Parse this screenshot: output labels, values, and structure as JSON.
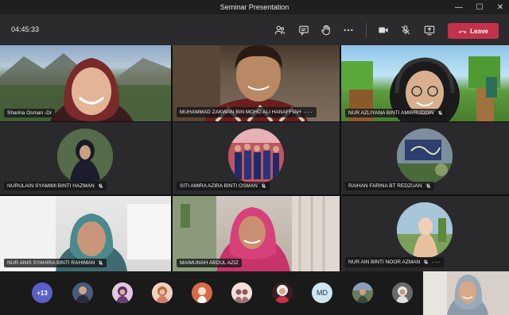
{
  "window": {
    "title": "Seminar Presentation",
    "controls": [
      "—",
      "☐",
      "✕"
    ]
  },
  "toolbar": {
    "timer": "04:45:33",
    "leave_label": "Leave",
    "icons": [
      "people-icon",
      "chat-icon",
      "raise-hand-icon",
      "more-options-icon",
      "camera-icon",
      "mic-off-icon",
      "share-screen-icon"
    ]
  },
  "tiles": [
    {
      "name": "Sharina Osman -Dr",
      "mic_off": false,
      "more": false
    },
    {
      "name": "MUHAMMAD ZAKWAN BIN MOHD ALI HANAFFIAH",
      "mic_off": false,
      "more": true
    },
    {
      "name": "NUR AZLIYANA BINTI AMIRRUDDIN",
      "mic_off": true,
      "more": false
    },
    {
      "name": "NURULAIN SYAMIMI BINTI HAZMAN",
      "mic_off": true,
      "more": false
    },
    {
      "name": "SITI AMIRA AZIRA BINTI OSMAN",
      "mic_off": true,
      "more": false
    },
    {
      "name": "RAIHAN FARINA BT REDZUAN",
      "mic_off": true,
      "more": false
    },
    {
      "name": "NUR ANIS SYAHIRA BINTI RAHIMAN",
      "mic_off": true,
      "more": false
    },
    {
      "name": "MAIMUNAH ABDUL AZIZ",
      "mic_off": false,
      "more": false
    },
    {
      "name": "NUR AIN BINTI NOOR AZMAN",
      "mic_off": true,
      "more": true
    }
  ],
  "overflow": {
    "more_count": "+13",
    "initials_badge": "MD"
  },
  "colors": {
    "leave": "#c4314b",
    "toolbar": "#2b2b2d",
    "tile": "#2a2a2c",
    "accent": "#5b5fc7"
  }
}
